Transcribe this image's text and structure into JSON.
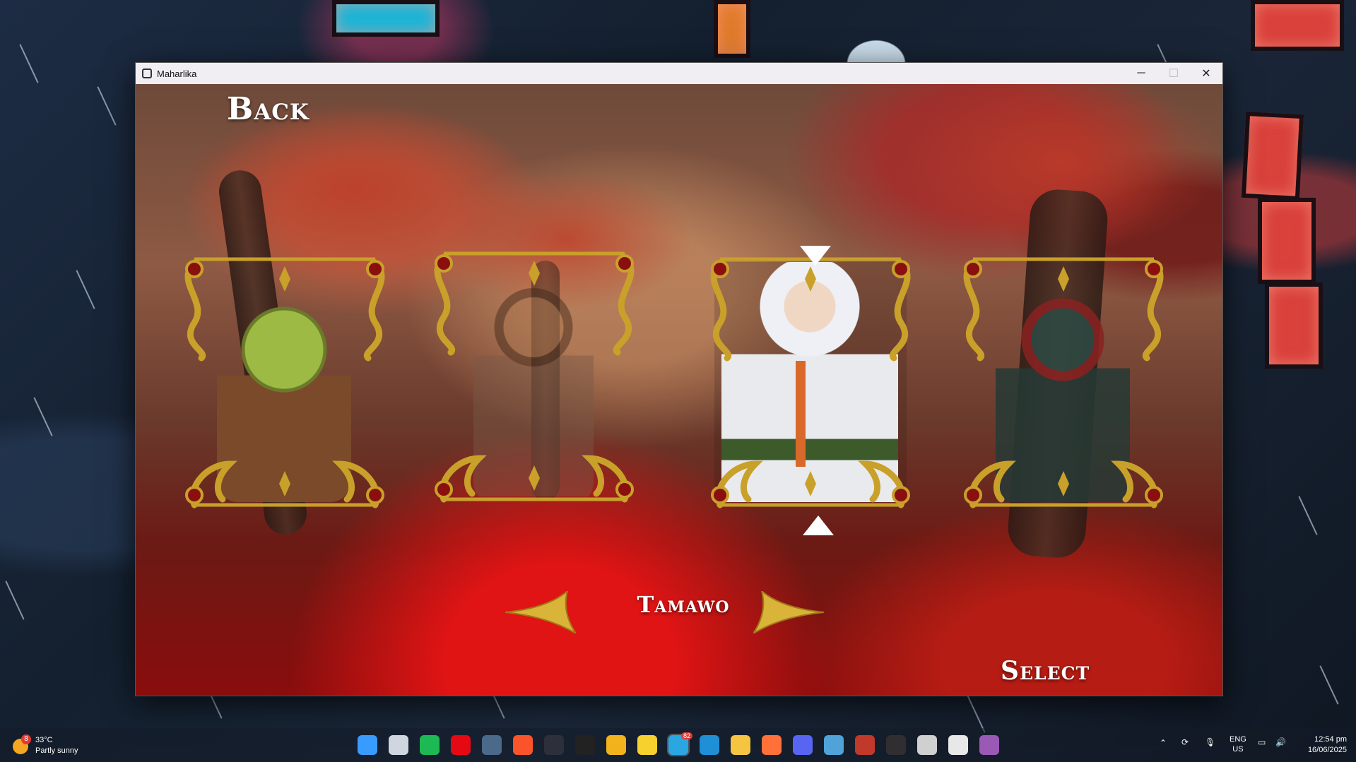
{
  "window": {
    "title": "Maharlika",
    "minimize_glyph": "─",
    "maximize_glyph": "☐",
    "close_glyph": "✕"
  },
  "menu": {
    "back_label": "Back",
    "select_label": "Select",
    "selected_character": "Tamawo"
  },
  "carousel": {
    "selected_index": 2,
    "cards": [
      {
        "name": "goblin",
        "skin": "#8fae3a",
        "hair": "#5a3a1e",
        "outfit": "#7a4a2a",
        "dim": false
      },
      {
        "name": "warrior-woman",
        "skin": "#a8744e",
        "hair": "#3a2418",
        "outfit": "#6a4a3a",
        "dim": true
      },
      {
        "name": "tamawo",
        "skin": "#f0d7c4",
        "hair": "#eef0f5",
        "outfit": "#f4f4f4",
        "dim": false
      },
      {
        "name": "demon",
        "skin": "#2c4a44",
        "hair": "#8a2222",
        "outfit": "#1e2a30",
        "dim": false
      }
    ]
  },
  "colors": {
    "frame_gold": "#c9a02a",
    "frame_red": "#8a0f0f",
    "arrow_white": "#ffffff"
  },
  "taskbar": {
    "weather_temp": "33°C",
    "weather_desc": "Partly sunny",
    "weather_badge": "8",
    "telegram_badge": "82",
    "lang_line1": "ENG",
    "lang_line2": "US",
    "time": "12:54 pm",
    "date": "16/06/2025",
    "apps": [
      "windows-start",
      "file-explorer-alt",
      "spotify",
      "netflix",
      "steam",
      "brave",
      "terminal",
      "cursor",
      "figma-like",
      "sticky-notes",
      "telegram",
      "edge",
      "file-explorer",
      "firefox",
      "discord",
      "globe",
      "archive",
      "obs",
      "unity",
      "media-player",
      "folder-purple"
    ]
  }
}
